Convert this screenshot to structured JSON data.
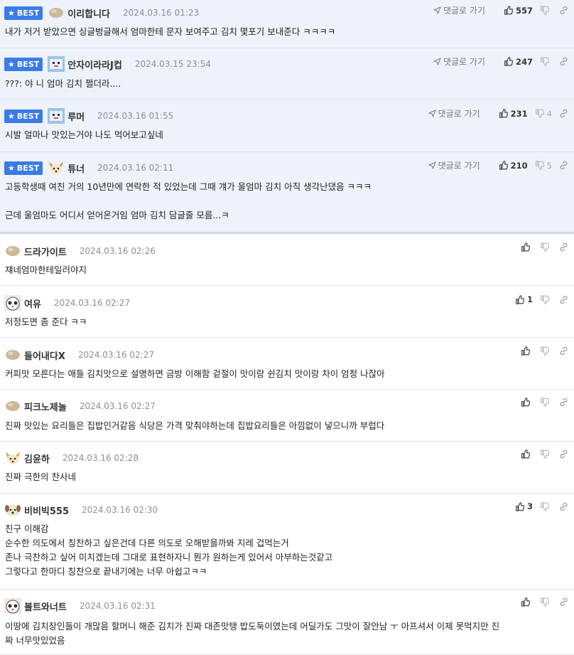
{
  "labels": {
    "best": "BEST",
    "reply_go": "댓글로 가기"
  },
  "comments": [
    {
      "best": true,
      "nick": "이리합니다",
      "date": "2024.03.16 01:23",
      "likes": "557",
      "dislikes": "",
      "avatar": "potato-avatar",
      "lines": [
        "내가 저거 받았으면 싱글벙글해서 엄마한테 문자 보여주고 김치 몇포기 보내준다 ㅋㅋㅋㅋ"
      ]
    },
    {
      "best": true,
      "nick": "안자이라라J컵",
      "date": "2024.03.15 23:54",
      "likes": "247",
      "dislikes": "",
      "avatar": "pixel-avatar",
      "lines": [
        "???: 야 니 엄마 김치 쩔더라...."
      ]
    },
    {
      "best": true,
      "nick": "루머",
      "date": "2024.03.16 01:55",
      "likes": "231",
      "dislikes": "4",
      "avatar": "pixel-avatar",
      "lines": [
        "시발 얼마나 맛있는거야 나도 먹어보고싶네"
      ]
    },
    {
      "best": true,
      "nick": "튜너",
      "date": "2024.03.16 02:11",
      "likes": "210",
      "dislikes": "5",
      "avatar": "dog-avatar",
      "lines": [
        "고등학생때 여친 거의 10년만에 연락한 적 있었는데 그때 걔가 울엄마 김치 아직 생각난댔음 ㅋㅋㅋ",
        "",
        "근데 울엄마도 어디서 얻어온거임 엄마 김치 담글줄 모름...ㅋ"
      ]
    },
    {
      "best": false,
      "nick": "드라가이트",
      "date": "2024.03.16 02:26",
      "likes": "",
      "dislikes": "",
      "avatar": "potato-avatar",
      "lines": [
        "쟤네엄마한테일러야지"
      ]
    },
    {
      "best": false,
      "nick": "여유",
      "date": "2024.03.16 02:27",
      "likes": "1",
      "dislikes": "",
      "avatar": "panda-avatar",
      "lines": [
        "저정도면 좀 준다 ㅋㅋ"
      ]
    },
    {
      "best": false,
      "nick": "들어내다X",
      "date": "2024.03.16 02:27",
      "likes": "",
      "dislikes": "",
      "avatar": "potato-avatar",
      "lines": [
        "커피맛 모른다는 애들 김치맛으로 설명하면 금방 이해함 겉절이 맛이랑 쉰김치 맛이랑 차이 엄청 나잖아"
      ]
    },
    {
      "best": false,
      "nick": "피크노제놀",
      "date": "2024.03.16 02:27",
      "likes": "",
      "dislikes": "",
      "avatar": "potato-avatar",
      "lines": [
        "진짜 맛있는 요리들은 집밥인거같음 식당은 가격 맞춰야하는데 집밥요리들은 아낌없이 넣으니까 부럽다"
      ]
    },
    {
      "best": false,
      "nick": "김윤하",
      "date": "2024.03.16 02:28",
      "likes": "",
      "dislikes": "",
      "avatar": "dog-avatar",
      "lines": [
        "진짜 극한의 찬사네"
      ]
    },
    {
      "best": false,
      "nick": "비비빅555",
      "date": "2024.03.16 02:30",
      "likes": "3",
      "dislikes": "",
      "avatar": "puppy-avatar",
      "lines": [
        "친구 이해감",
        "순수한 의도에서 칭찬하고 싶은건데 다른 의도로 오해받을까봐 지레 겁먹는거",
        "존나 극찬하고 싶어 미치겠는데 그대로 표현하자니 뭔가 원하는게 있어서 아부하는것같고",
        "그렇다고 한마디 칭찬으로 끝내기에는 너무 아쉽고ㅋㅋ"
      ]
    },
    {
      "best": false,
      "nick": "볼트와너트",
      "date": "2024.03.16 02:31",
      "likes": "",
      "dislikes": "",
      "avatar": "panda-avatar",
      "lines": [
        "이땅에 김치장인들이 개많음 할머니 해준 김치가 진짜 대존맛탱 밥도둑이였는데 어딜가도 그맛이 잘안남 ㅜ 아프셔서 이제 못먹지만 진",
        "짜 너무맛있었음"
      ]
    }
  ]
}
